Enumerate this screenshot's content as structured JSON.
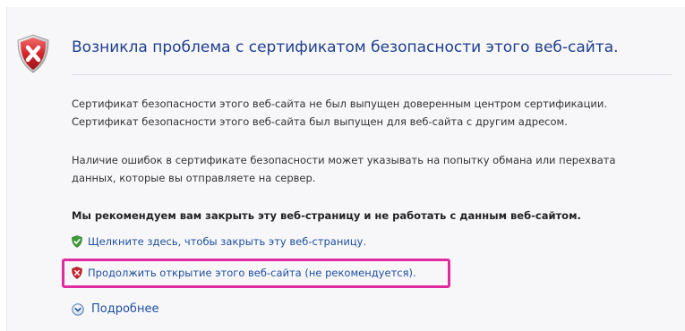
{
  "header": {
    "title": "Возникла проблема с сертификатом безопасности этого веб-сайта."
  },
  "body": {
    "paragraph1_line1": "Сертификат безопасности этого веб-сайта не был выпущен доверенным центром сертификации.",
    "paragraph1_line2": "Сертификат безопасности этого веб-сайта был выпущен для веб-сайта с другим адресом.",
    "paragraph2_line1": "Наличие ошибок в сертификате безопасности может указывать на попытку обмана или перехвата",
    "paragraph2_line2": "данных, которые вы отправляете на сервер.",
    "recommendation": "Мы рекомендуем вам закрыть эту веб-страницу и не работать с данным веб-сайтом."
  },
  "links": {
    "close_page": "Щелкните здесь, чтобы закрыть эту веб-страницу.",
    "continue_site": "Продолжить открытие этого веб-сайта (не рекомендуется).",
    "more_info": "Подробнее"
  },
  "icons": {
    "header": "red-shield-x-icon",
    "close_page": "green-shield-check-icon",
    "continue_site": "red-shield-x-icon",
    "more_info": "chevron-down-circle-icon"
  },
  "colors": {
    "title": "#1e3e8e",
    "link": "#1d4f9e",
    "highlight": "#e02c9f",
    "danger": "#c8242c",
    "safe": "#3f9c35"
  }
}
